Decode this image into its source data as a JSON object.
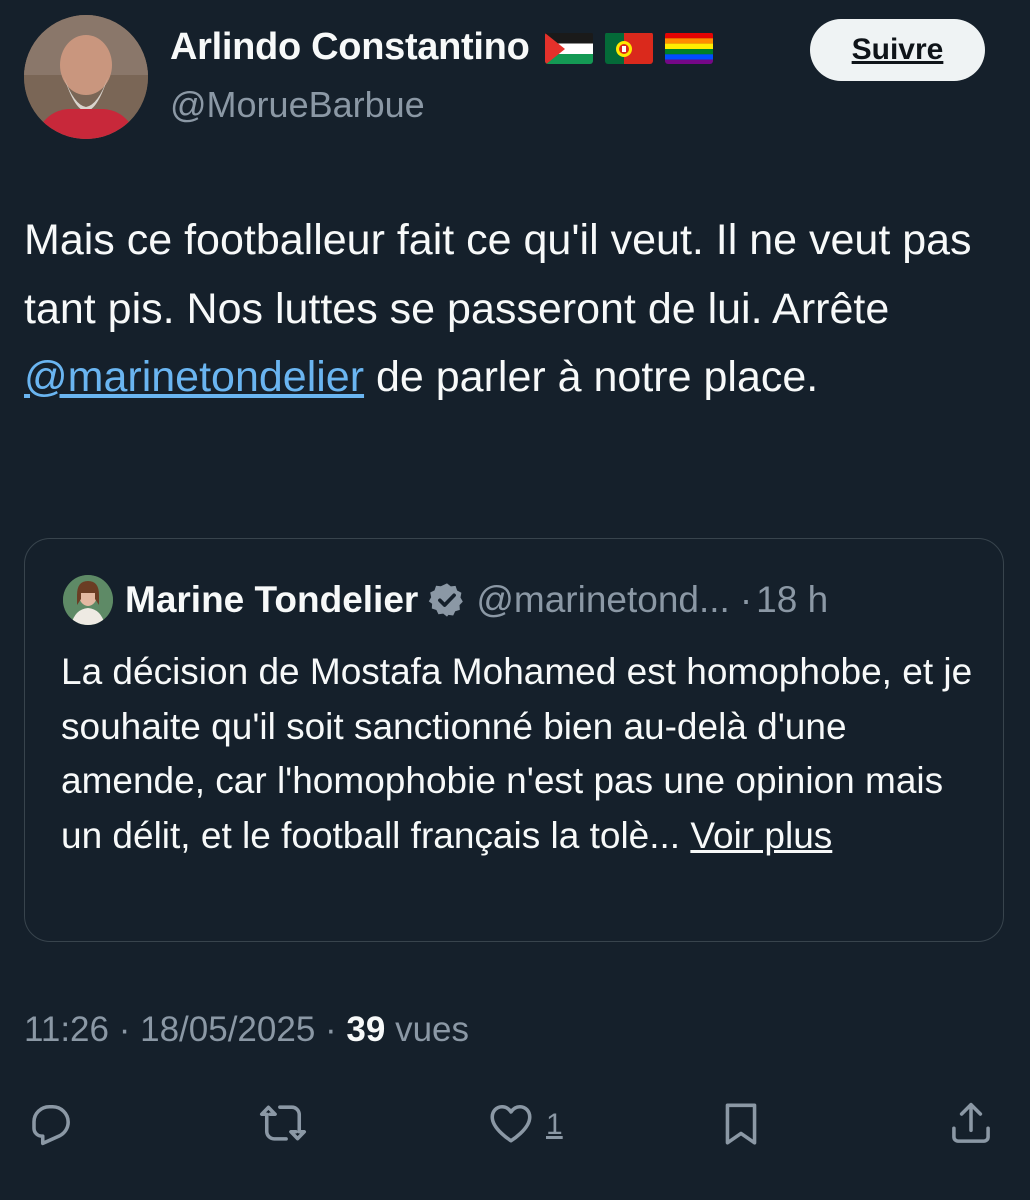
{
  "author": {
    "display_name": "Arlindo Constantino",
    "handle": "@MorueBarbue",
    "flags": [
      "palestine-flag-icon",
      "portugal-flag-icon",
      "rainbow-flag-icon"
    ]
  },
  "follow_button": {
    "label": "Suivre"
  },
  "tweet": {
    "text_before": "Mais ce footballeur fait ce qu'il veut. Il ne veut pas tant pis. Nos luttes se passeront de lui. Arrête ",
    "mention": "@marinetondelier",
    "text_after": " de parler à notre place."
  },
  "quoted_tweet": {
    "display_name": "Marine Tondelier",
    "verified_icon": "verified-badge-icon",
    "handle": "@marinetond...",
    "separator": "·",
    "time": "18 h",
    "text": "La décision de Mostafa Mohamed est homophobe, et je souhaite qu'il soit sanctionné bien au-delà d'une amende, car l'homophobie n'est pas une opinion mais un délit, et le football français la tolè...",
    "see_more": "Voir plus"
  },
  "meta": {
    "time": "11:26",
    "date": "18/05/2025",
    "separator": "·",
    "views_count": "39",
    "views_label": "vues"
  },
  "actions": {
    "reply_icon": "reply-icon",
    "retweet_icon": "retweet-icon",
    "like_icon": "heart-icon",
    "like_count": "1",
    "bookmark_icon": "bookmark-icon",
    "share_icon": "share-icon"
  },
  "colors": {
    "background": "#15202b",
    "text": "#f7f9f9",
    "secondary_text": "#8b98a5",
    "mention": "#6ab5f1",
    "border": "#38444d",
    "button_bg": "#eff3f4"
  }
}
